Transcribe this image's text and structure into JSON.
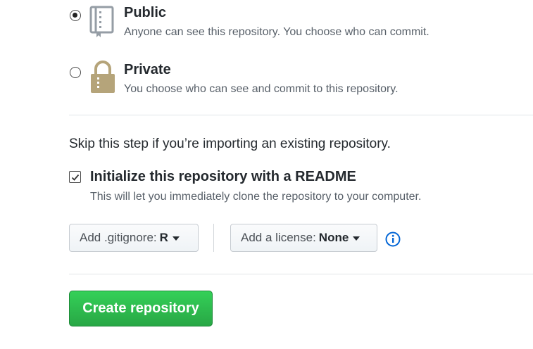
{
  "visibility": {
    "public": {
      "title": "Public",
      "description": "Anyone can see this repository. You choose who can commit.",
      "selected": true,
      "icon": "repo-book-icon"
    },
    "private": {
      "title": "Private",
      "description": "You choose who can see and commit to this repository.",
      "selected": false,
      "icon": "lock-icon"
    }
  },
  "init": {
    "skip_note": "Skip this step if you’re importing an existing repository.",
    "readme_label": "Initialize this repository with a README",
    "readme_checked": true,
    "readme_note": "This will let you immediately clone the repository to your computer."
  },
  "options": {
    "gitignore_label": "Add .gitignore:",
    "gitignore_value": "R",
    "license_label": "Add a license:",
    "license_value": "None",
    "info_icon": "info-icon"
  },
  "actions": {
    "create_label": "Create repository"
  },
  "colors": {
    "primary_green": "#28a745",
    "info_blue": "#0366d6",
    "icon_gray": "#959da5",
    "lock_gold": "#b5a47a"
  }
}
